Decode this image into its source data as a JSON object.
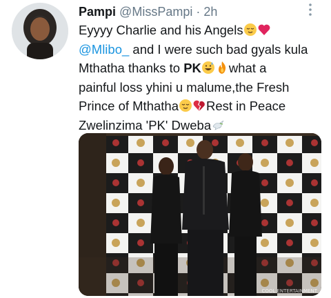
{
  "tweet": {
    "author_name": "Pampi",
    "handle": "@MissPampi",
    "separator": "·",
    "time": "2h",
    "lines": {
      "l1_text": "Eyyyy Charlie and his Angels",
      "l2_mention": "@Mlibo_",
      "l2_text": " and I were such bad gyals kula",
      "l3_text": "Mthatha thanks to ",
      "l3_bold": "PK",
      "l3_text2": "what a",
      "l4_text": "painful loss yhini u malume,the Fresh",
      "l5_text": "Prince of Mthatha",
      "l5_text2": "Rest in Peace",
      "l6_text": "Zwelinzima 'PK' Dweba"
    },
    "emojis": [
      "relieved-face",
      "red-heart",
      "grinning-sweat",
      "fire",
      "relieved-face",
      "broken-heart",
      "dove"
    ],
    "media": {
      "watermark": "COOL ENTERTAINMENT"
    }
  },
  "colors": {
    "text": "#14171a",
    "secondary": "#657786",
    "link": "#1b95e0"
  }
}
